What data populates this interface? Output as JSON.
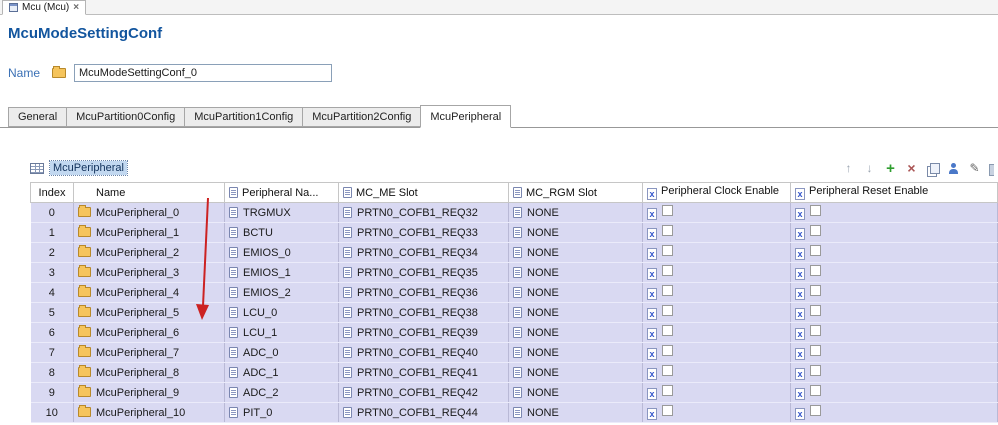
{
  "editor_tab": {
    "title": "Mcu (Mcu)",
    "close_glyph": "×"
  },
  "page": {
    "title": "McuModeSettingConf",
    "name_label": "Name",
    "name_value": "McuModeSettingConf_0"
  },
  "tabs": [
    "General",
    "McuPartition0Config",
    "McuPartition1Config",
    "McuPartition2Config",
    "McuPeripheral"
  ],
  "active_tab": "McuPeripheral",
  "toolbar": {
    "icons": [
      "move-up",
      "move-down",
      "add",
      "delete",
      "copy",
      "wizard",
      "edit",
      "more"
    ]
  },
  "table": {
    "caption": "McuPeripheral",
    "columns": [
      {
        "label": "Index"
      },
      {
        "label": "Name"
      },
      {
        "label": "Peripheral Na...",
        "icon": "document-icon"
      },
      {
        "label": "MC_ME Slot",
        "icon": "document-icon"
      },
      {
        "label": "MC_RGM Slot",
        "icon": "document-icon"
      },
      {
        "label": "Peripheral Clock Enable",
        "icon": "boolean-icon"
      },
      {
        "label": "Peripheral Reset Enable",
        "icon": "boolean-icon"
      }
    ],
    "rows": [
      {
        "index": "0",
        "name": "McuPeripheral_0",
        "peripheral_name": "TRGMUX",
        "mc_me_slot": "PRTN0_COFB1_REQ32",
        "mc_rgm_slot": "NONE",
        "clock_enable": false,
        "reset_enable": false
      },
      {
        "index": "1",
        "name": "McuPeripheral_1",
        "peripheral_name": "BCTU",
        "mc_me_slot": "PRTN0_COFB1_REQ33",
        "mc_rgm_slot": "NONE",
        "clock_enable": false,
        "reset_enable": false
      },
      {
        "index": "2",
        "name": "McuPeripheral_2",
        "peripheral_name": "EMIOS_0",
        "mc_me_slot": "PRTN0_COFB1_REQ34",
        "mc_rgm_slot": "NONE",
        "clock_enable": false,
        "reset_enable": false
      },
      {
        "index": "3",
        "name": "McuPeripheral_3",
        "peripheral_name": "EMIOS_1",
        "mc_me_slot": "PRTN0_COFB1_REQ35",
        "mc_rgm_slot": "NONE",
        "clock_enable": false,
        "reset_enable": false
      },
      {
        "index": "4",
        "name": "McuPeripheral_4",
        "peripheral_name": "EMIOS_2",
        "mc_me_slot": "PRTN0_COFB1_REQ36",
        "mc_rgm_slot": "NONE",
        "clock_enable": false,
        "reset_enable": false
      },
      {
        "index": "5",
        "name": "McuPeripheral_5",
        "peripheral_name": "LCU_0",
        "mc_me_slot": "PRTN0_COFB1_REQ38",
        "mc_rgm_slot": "NONE",
        "clock_enable": false,
        "reset_enable": false
      },
      {
        "index": "6",
        "name": "McuPeripheral_6",
        "peripheral_name": "LCU_1",
        "mc_me_slot": "PRTN0_COFB1_REQ39",
        "mc_rgm_slot": "NONE",
        "clock_enable": false,
        "reset_enable": false
      },
      {
        "index": "7",
        "name": "McuPeripheral_7",
        "peripheral_name": "ADC_0",
        "mc_me_slot": "PRTN0_COFB1_REQ40",
        "mc_rgm_slot": "NONE",
        "clock_enable": false,
        "reset_enable": false
      },
      {
        "index": "8",
        "name": "McuPeripheral_8",
        "peripheral_name": "ADC_1",
        "mc_me_slot": "PRTN0_COFB1_REQ41",
        "mc_rgm_slot": "NONE",
        "clock_enable": false,
        "reset_enable": false
      },
      {
        "index": "9",
        "name": "McuPeripheral_9",
        "peripheral_name": "ADC_2",
        "mc_me_slot": "PRTN0_COFB1_REQ42",
        "mc_rgm_slot": "NONE",
        "clock_enable": false,
        "reset_enable": false
      },
      {
        "index": "10",
        "name": "McuPeripheral_10",
        "peripheral_name": "PIT_0",
        "mc_me_slot": "PRTN0_COFB1_REQ44",
        "mc_rgm_slot": "NONE",
        "clock_enable": false,
        "reset_enable": false
      }
    ]
  },
  "annotation": {
    "type": "red-down-arrow",
    "color": "#cc2222"
  }
}
